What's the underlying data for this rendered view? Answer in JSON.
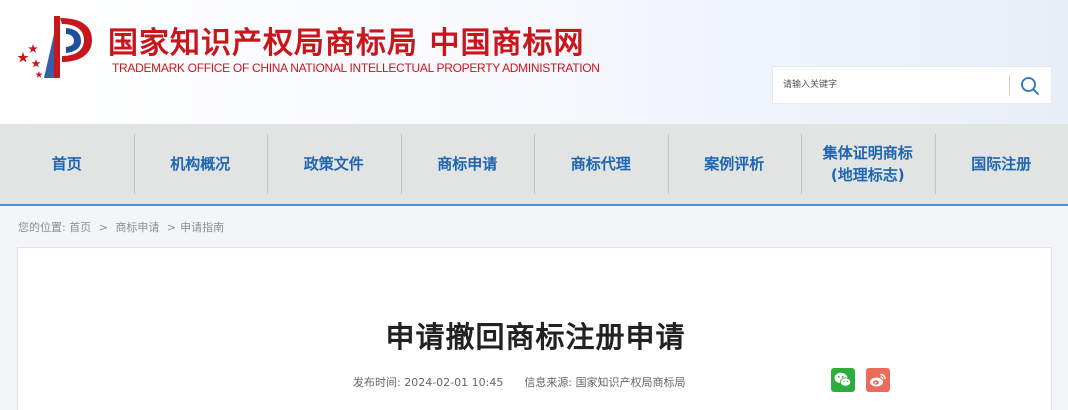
{
  "header": {
    "logo_cn": "国家知识产权局商标局 中国商标网",
    "logo_en": "TRADEMARK OFFICE OF CHINA NATIONAL INTELLECTUAL PROPERTY ADMINISTRATION"
  },
  "search": {
    "placeholder": "请输入关键字",
    "value": ""
  },
  "nav": {
    "items": [
      {
        "label": "首页"
      },
      {
        "label": "机构概况"
      },
      {
        "label": "政策文件"
      },
      {
        "label": "商标申请"
      },
      {
        "label": "商标代理"
      },
      {
        "label": "案例评析"
      },
      {
        "label": "集体证明商标\n(地理标志)"
      },
      {
        "label": "国际注册"
      }
    ]
  },
  "breadcrumb": {
    "prefix": "您的位置:",
    "home": "首页",
    "sep1": ">",
    "level1": "商标申请",
    "sep2": ">",
    "level2": "申请指南"
  },
  "article": {
    "title": "申请撤回商标注册申请",
    "publish_label": "发布时间:",
    "publish_time": "2024-02-01 10:45",
    "source_label": "信息来源:",
    "source": "国家知识产权局商标局"
  },
  "colors": {
    "brand_red": "#c8161d",
    "nav_blue": "#1f66b2",
    "wechat_green": "#2bae3d",
    "weibo_red": "#e86b5b"
  },
  "icons": {
    "search": "search-icon",
    "wechat": "wechat-icon",
    "weibo": "weibo-icon",
    "logo": "cnipa-logo-icon"
  }
}
